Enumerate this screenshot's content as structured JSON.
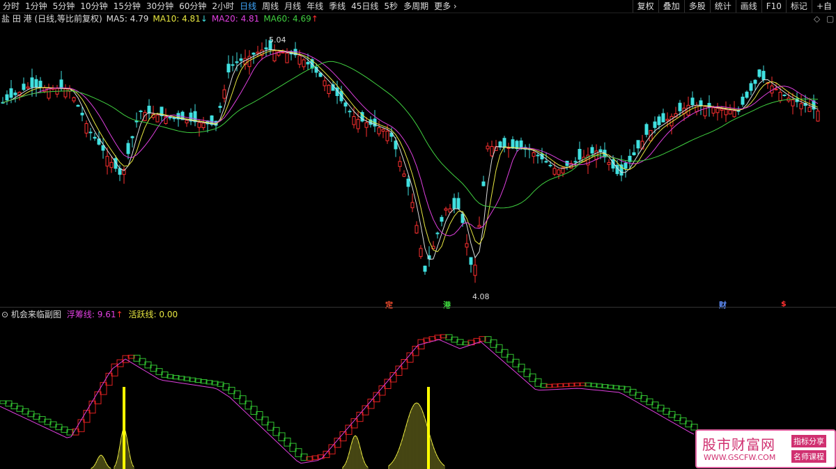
{
  "toolbar": {
    "periods": [
      "分时",
      "1分钟",
      "5分钟",
      "10分钟",
      "15分钟",
      "30分钟",
      "60分钟",
      "2小时",
      "日线",
      "周线",
      "月线",
      "年线",
      "季线",
      "45日线",
      "5秒",
      "多周期",
      "更多 ›"
    ],
    "active_period": "日线",
    "tools": [
      "复权",
      "叠加",
      "多股",
      "统计",
      "画线",
      "F10",
      "标记",
      "+自"
    ]
  },
  "legend": {
    "title": "盐 田 港 (日线,等比前复权)",
    "ma5": "MA5: 4.79",
    "ma10": "MA10: 4.81",
    "ma10_arrow": "↓",
    "ma20": "MA20: 4.81",
    "ma60": "MA60: 4.69",
    "ma60_arrow": "↑"
  },
  "price_labels": {
    "high": "5.04",
    "low": "4.08"
  },
  "markers": [
    {
      "text": "定",
      "color": "#ff5030"
    },
    {
      "text": "港",
      "color": "#40e040"
    },
    {
      "text": "财",
      "color": "#6090ff"
    },
    {
      "text": "$",
      "color": "#ff3030"
    }
  ],
  "sub_legend": {
    "title": "机会来临副图",
    "float_line": "浮筹线: 9.61",
    "float_arrow": "↑",
    "active_line": "活跃线: 0.00"
  },
  "watermark": {
    "big": "股市财富网",
    "url": "WWW.GSCFW.COM",
    "tag1": "指标分享",
    "tag2": "名师课程"
  },
  "colors": {
    "up": "#ff3030",
    "down": "#40e0e0",
    "ma5": "#dddddd",
    "ma10": "#e8e840",
    "ma20": "#e040e0",
    "ma60": "#40d040"
  }
}
